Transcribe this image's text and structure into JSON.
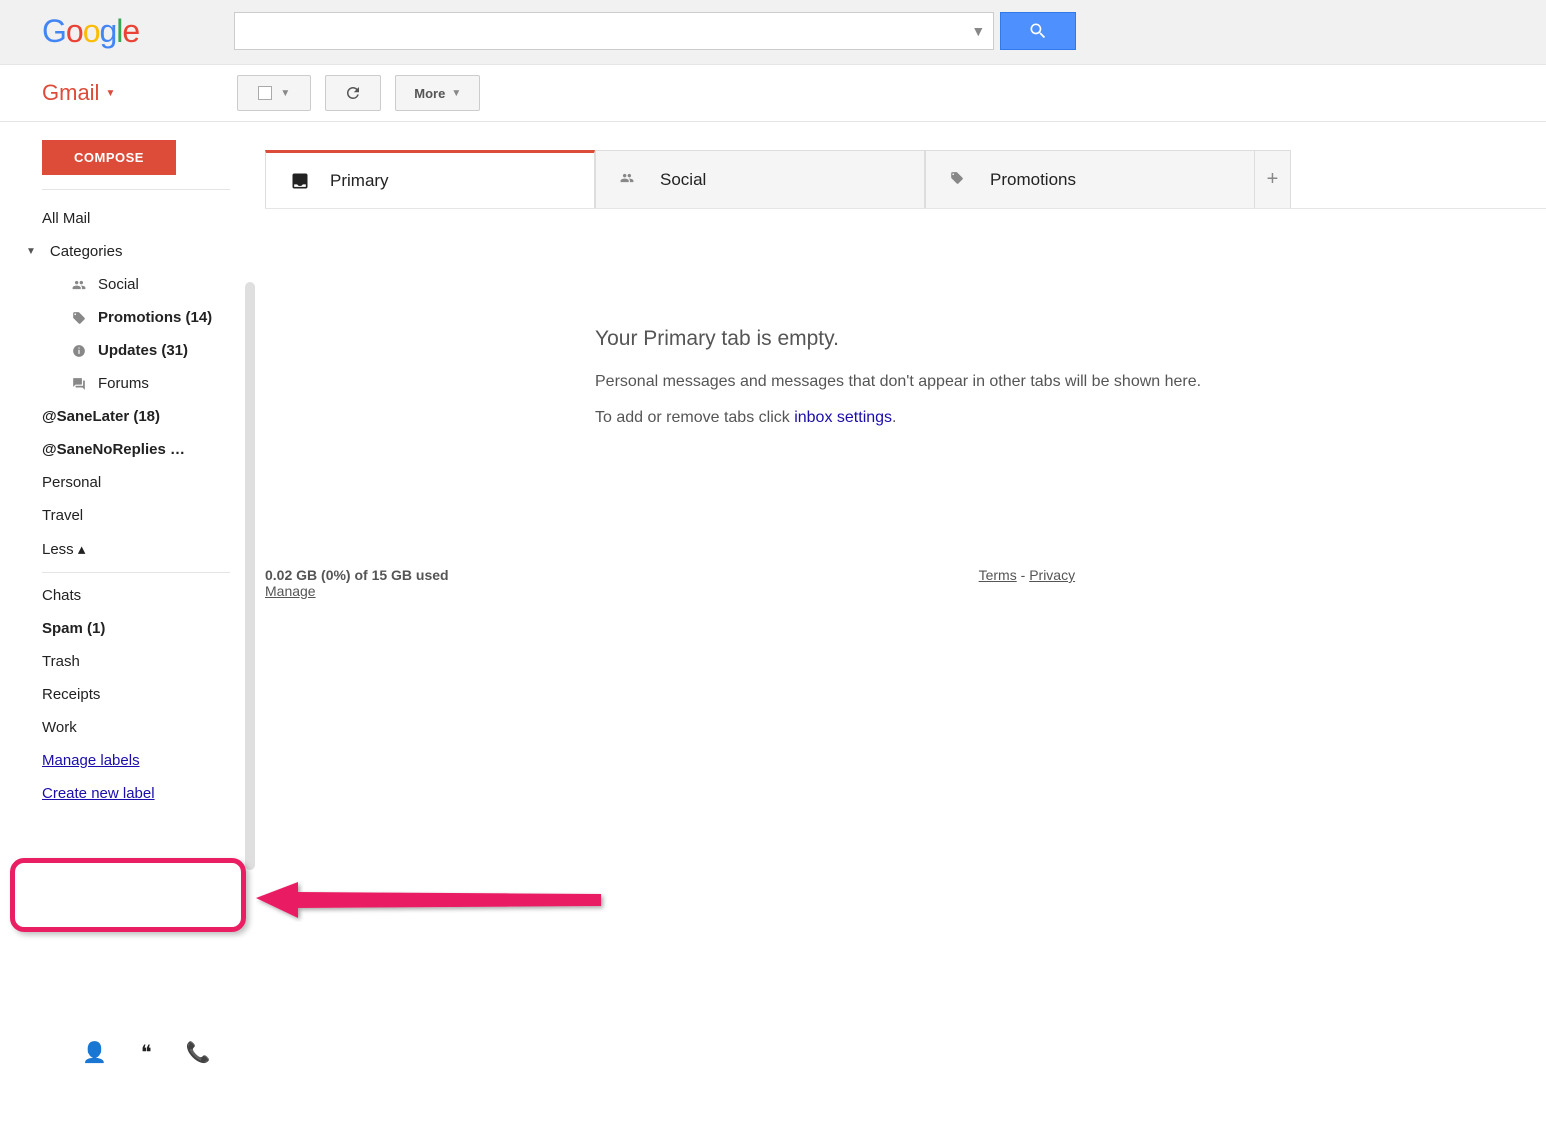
{
  "header": {
    "logo": "Google",
    "search_placeholder": ""
  },
  "app": {
    "title": "Gmail"
  },
  "toolbar": {
    "more_label": "More"
  },
  "sidebar": {
    "compose_label": "COMPOSE",
    "items": [
      {
        "label": "All Mail",
        "bold": false
      },
      {
        "label": "Categories",
        "bold": false,
        "expandable": true
      },
      {
        "label": "Social",
        "bold": false,
        "indent": true,
        "icon": "people"
      },
      {
        "label": "Promotions (14)",
        "bold": true,
        "indent": true,
        "icon": "tag"
      },
      {
        "label": "Updates (31)",
        "bold": true,
        "indent": true,
        "icon": "info"
      },
      {
        "label": "Forums",
        "bold": false,
        "indent": true,
        "icon": "forum"
      },
      {
        "label": "@SaneLater (18)",
        "bold": true
      },
      {
        "label": "@SaneNoReplies …",
        "bold": true
      },
      {
        "label": "Personal",
        "bold": false
      },
      {
        "label": "Travel",
        "bold": false
      },
      {
        "label": "Less ▴",
        "bold": false
      },
      {
        "divider": true
      },
      {
        "label": "Chats",
        "bold": false
      },
      {
        "label": "Spam (1)",
        "bold": true
      },
      {
        "label": "Trash",
        "bold": false
      },
      {
        "label": "Receipts",
        "bold": false
      },
      {
        "label": "Work",
        "bold": false
      },
      {
        "label": "Manage labels",
        "link": true
      },
      {
        "label": "Create new label",
        "link": true
      }
    ]
  },
  "tabs": [
    {
      "label": "Primary",
      "icon": "inbox",
      "active": true
    },
    {
      "label": "Social",
      "icon": "people",
      "active": false
    },
    {
      "label": "Promotions",
      "icon": "tag",
      "active": false
    }
  ],
  "empty": {
    "heading": "Your Primary tab is empty.",
    "line1": "Personal messages and messages that don't appear in other tabs will be shown here.",
    "line2_prefix": "To add or remove tabs click ",
    "line2_link": "inbox settings",
    "line2_suffix": "."
  },
  "footer": {
    "usage": "0.02 GB (0%) of 15 GB used",
    "manage": "Manage",
    "terms": "Terms",
    "sep": " - ",
    "privacy": "Privacy"
  }
}
